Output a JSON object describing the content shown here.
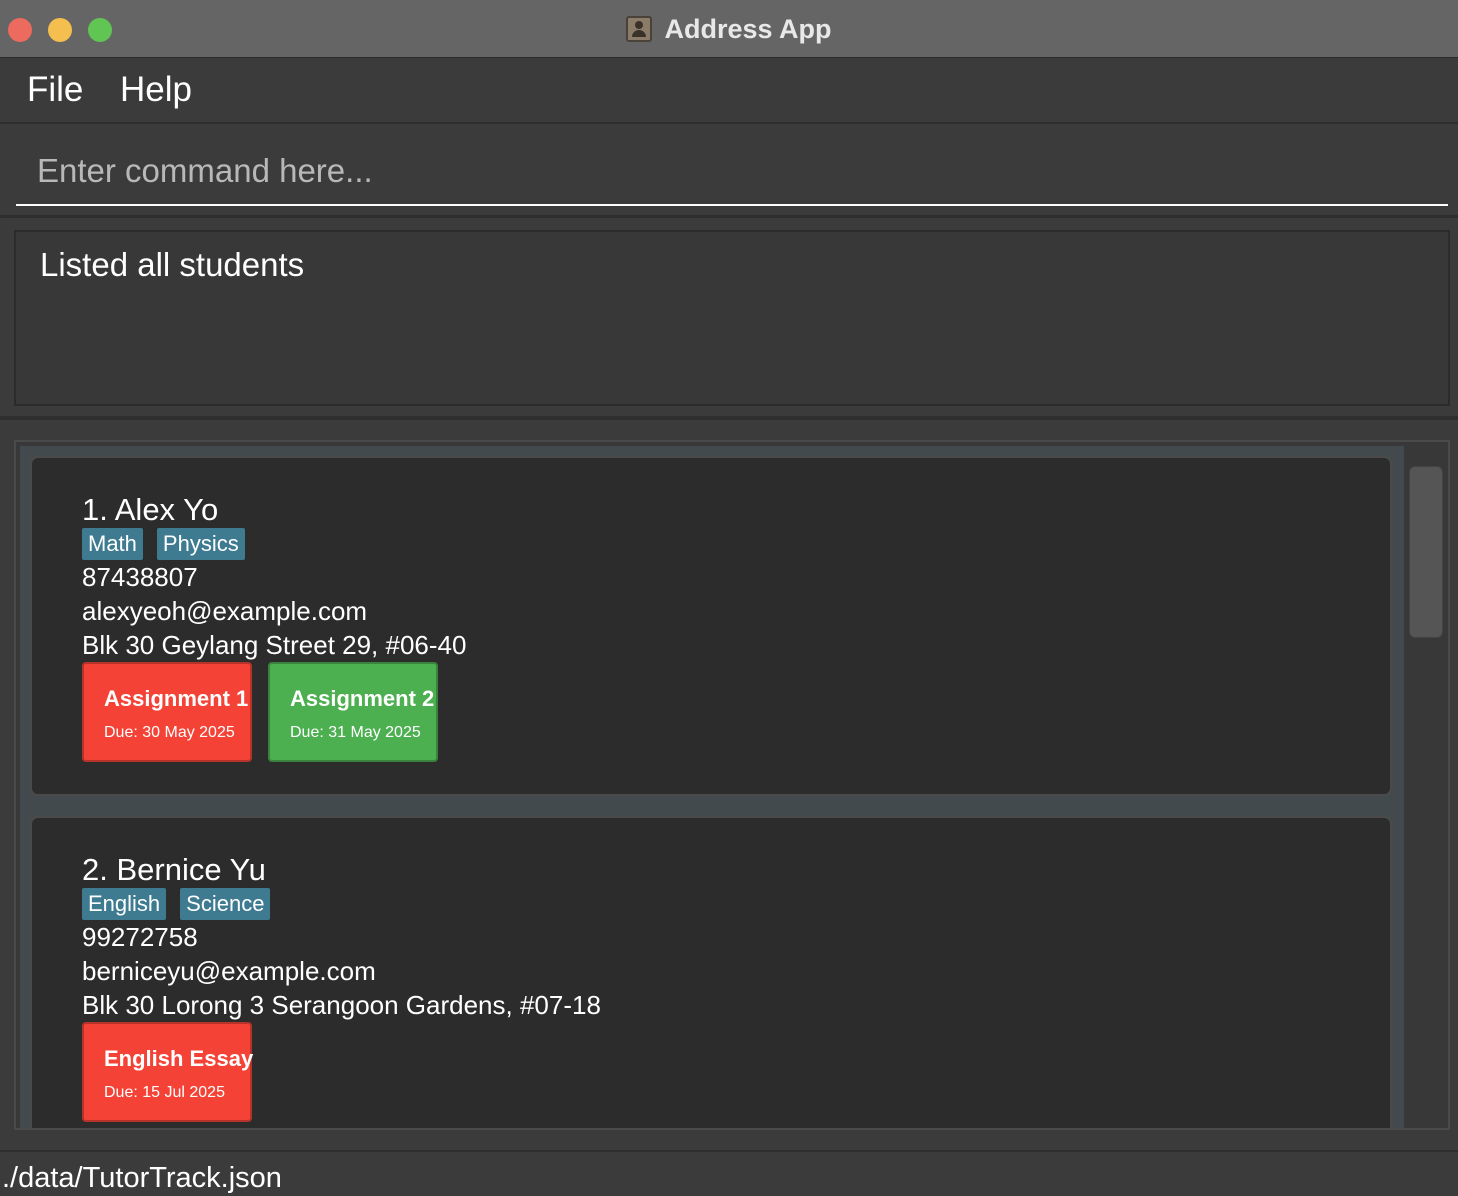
{
  "window": {
    "title": "Address App"
  },
  "menu": {
    "file": "File",
    "help": "Help"
  },
  "command": {
    "placeholder": "Enter command here...",
    "value": ""
  },
  "result": {
    "message": "Listed all students"
  },
  "students": [
    {
      "name": "1. Alex Yo",
      "tags": [
        "Math",
        "Physics"
      ],
      "phone": "87438807",
      "email": "alexyeoh@example.com",
      "address": "Blk 30 Geylang Street 29, #06-40",
      "assignments": [
        {
          "title": "Assignment 1",
          "due": "Due: 30 May 2025",
          "color": "#f44336"
        },
        {
          "title": "Assignment 2",
          "due": "Due: 31 May 2025",
          "color": "#4caf50"
        }
      ]
    },
    {
      "name": "2. Bernice Yu",
      "tags": [
        "English",
        "Science"
      ],
      "phone": "99272758",
      "email": "berniceyu@example.com",
      "address": "Blk 30 Lorong 3 Serangoon Gardens, #07-18",
      "assignments": [
        {
          "title": "English Essay",
          "due": "Due: 15 Jul 2025",
          "color": "#f44336"
        }
      ]
    }
  ],
  "status": {
    "file_path": "./data/TutorTrack.json"
  },
  "colors": {
    "tag": "#3e7b91",
    "overdue": "#f44336",
    "done": "#4caf50",
    "background": "#3b3b3b"
  }
}
